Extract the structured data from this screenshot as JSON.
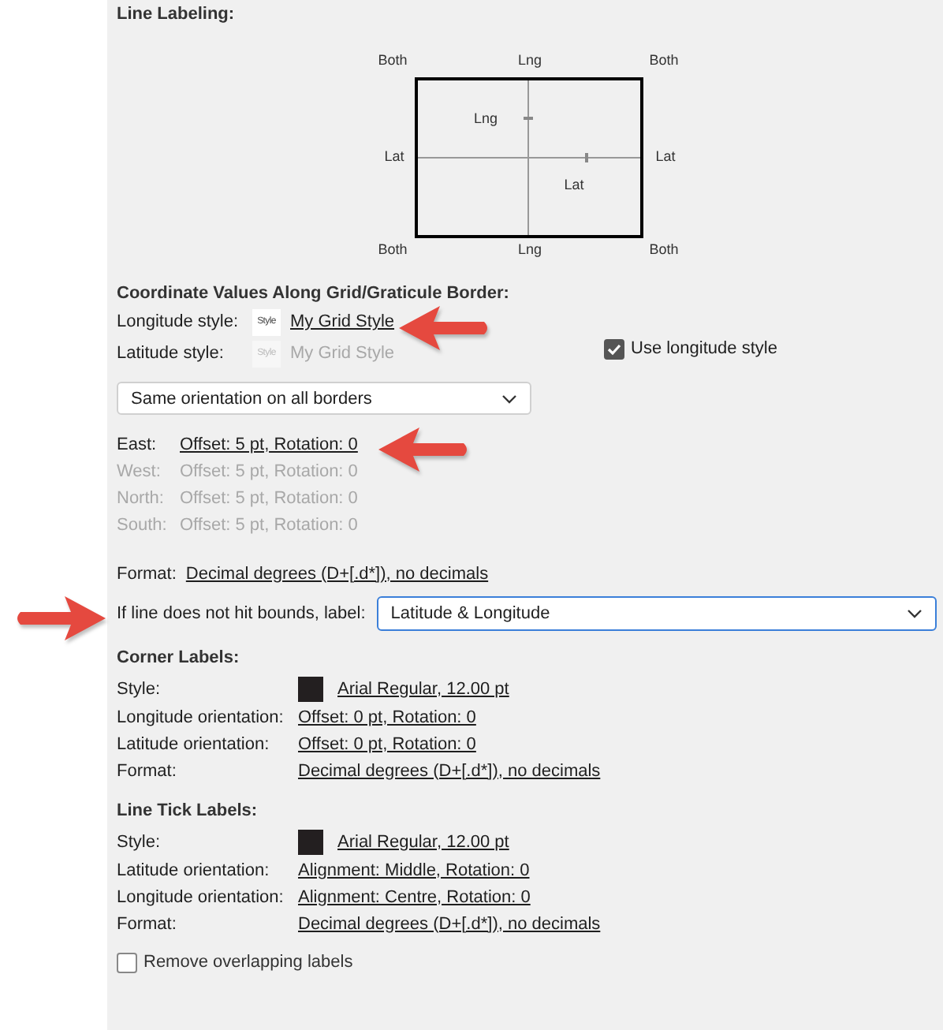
{
  "line_labeling": {
    "heading": "Line Labeling:",
    "diagram": {
      "top": [
        "Both",
        "Lng",
        "Both"
      ],
      "middle": [
        "Lat",
        "Lat"
      ],
      "bottom": [
        "Both",
        "Lng",
        "Both"
      ],
      "inner": [
        "Lng",
        "Lat"
      ]
    }
  },
  "coordinate_values": {
    "heading": "Coordinate Values Along Grid/Graticule Border:",
    "styles": [
      {
        "label": "Longitude style:",
        "preview": "Style",
        "value": "My Grid Style",
        "disabled": false
      },
      {
        "label": "Latitude style:",
        "preview": "Style",
        "value": "My Grid Style",
        "disabled": true
      }
    ],
    "use_longitude_style": {
      "label": "Use longitude style",
      "checked": true
    },
    "orientation_dropdown": {
      "value": "Same orientation on all borders"
    },
    "borders": [
      {
        "label": "East:",
        "value": "Offset: 5 pt, Rotation: 0",
        "disabled": false
      },
      {
        "label": "West:",
        "value": "Offset: 5 pt, Rotation: 0",
        "disabled": true
      },
      {
        "label": "North:",
        "value": "Offset: 5 pt, Rotation: 0",
        "disabled": true
      },
      {
        "label": "South:",
        "value": "Offset: 5 pt, Rotation: 0",
        "disabled": true
      }
    ],
    "format": {
      "label": "Format:",
      "value": "Decimal degrees (D+[.d*]), no decimals"
    }
  },
  "bounds": {
    "label": "If line does not hit bounds, label:",
    "value": "Latitude & Longitude"
  },
  "sections": [
    {
      "heading": "Corner Labels:",
      "rows": [
        {
          "kind": "swatch",
          "label": "Style:",
          "value": "Arial Regular, 12.00 pt"
        },
        {
          "kind": "link",
          "label": "Longitude orientation:",
          "value": "Offset: 0 pt, Rotation: 0"
        },
        {
          "kind": "link",
          "label": "Latitude orientation:",
          "value": "Offset: 0 pt, Rotation: 0"
        },
        {
          "kind": "link",
          "label": "Format:",
          "value": "Decimal degrees (D+[.d*]), no decimals"
        }
      ]
    },
    {
      "heading": "Line Tick Labels:",
      "rows": [
        {
          "kind": "swatch",
          "label": "Style:",
          "value": "Arial Regular, 12.00 pt"
        },
        {
          "kind": "link",
          "label": "Latitude orientation:",
          "value": "Alignment: Middle, Rotation: 0"
        },
        {
          "kind": "link",
          "label": "Longitude orientation:",
          "value": "Alignment: Centre, Rotation: 0"
        },
        {
          "kind": "link",
          "label": "Format:",
          "value": "Decimal degrees (D+[.d*]), no decimals"
        }
      ]
    }
  ],
  "remove_overlapping": {
    "label": "Remove overlapping labels",
    "checked": false
  }
}
